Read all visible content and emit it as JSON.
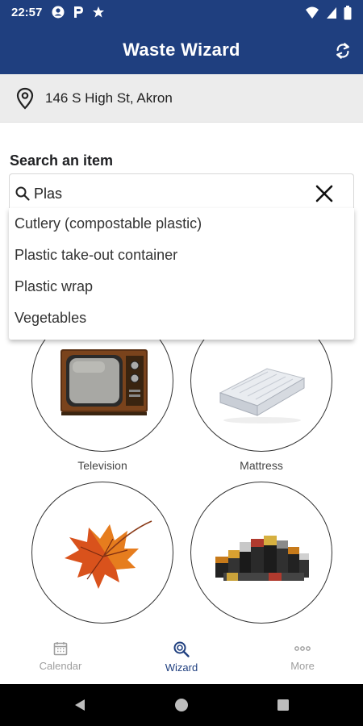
{
  "status_bar": {
    "time": "22:57"
  },
  "app_bar": {
    "title": "Waste Wizard",
    "icons": {
      "refresh": "refresh-icon"
    }
  },
  "address": {
    "text": "146 S High St, Akron",
    "icon": "location-pin-icon"
  },
  "search": {
    "label": "Search an item",
    "value": "Plas",
    "suggestions": [
      "Cutlery (compostable plastic)",
      "Plastic take-out container",
      "Plastic wrap",
      "Vegetables"
    ]
  },
  "tiles": [
    {
      "label": "Television",
      "icon": "television-image"
    },
    {
      "label": "Mattress",
      "icon": "mattress-image"
    },
    {
      "label": "",
      "icon": "maple-leaf-image"
    },
    {
      "label": "",
      "icon": "batteries-image"
    }
  ],
  "bottom_nav": {
    "items": [
      {
        "label": "Calendar",
        "icon": "calendar-icon",
        "active": false
      },
      {
        "label": "Wizard",
        "icon": "wizard-search-icon",
        "active": true
      },
      {
        "label": "More",
        "icon": "more-dots-icon",
        "active": false
      }
    ]
  },
  "colors": {
    "primary": "#1f3f7f",
    "address_bg": "#ececec",
    "nav_inactive": "#9e9e9e"
  }
}
